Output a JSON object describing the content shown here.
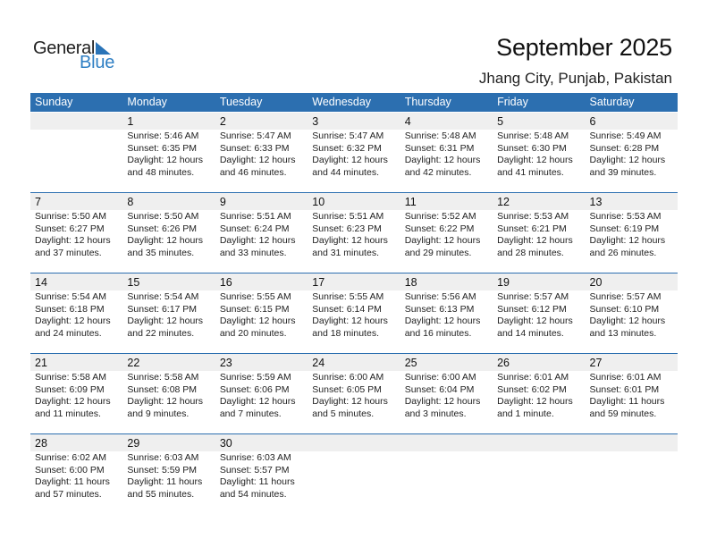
{
  "logo": {
    "general": "General",
    "blue": "Blue"
  },
  "header": {
    "title": "September 2025",
    "location": "Jhang City, Punjab, Pakistan"
  },
  "colors": {
    "accent": "#2c6fb0",
    "band": "#efefef",
    "logo_blue": "#2f7fc4"
  },
  "weekdays": [
    "Sunday",
    "Monday",
    "Tuesday",
    "Wednesday",
    "Thursday",
    "Friday",
    "Saturday"
  ],
  "weeks": [
    [
      null,
      {
        "day": "1",
        "sunrise": "Sunrise: 5:46 AM",
        "sunset": "Sunset: 6:35 PM",
        "daylight1": "Daylight: 12 hours",
        "daylight2": "and 48 minutes."
      },
      {
        "day": "2",
        "sunrise": "Sunrise: 5:47 AM",
        "sunset": "Sunset: 6:33 PM",
        "daylight1": "Daylight: 12 hours",
        "daylight2": "and 46 minutes."
      },
      {
        "day": "3",
        "sunrise": "Sunrise: 5:47 AM",
        "sunset": "Sunset: 6:32 PM",
        "daylight1": "Daylight: 12 hours",
        "daylight2": "and 44 minutes."
      },
      {
        "day": "4",
        "sunrise": "Sunrise: 5:48 AM",
        "sunset": "Sunset: 6:31 PM",
        "daylight1": "Daylight: 12 hours",
        "daylight2": "and 42 minutes."
      },
      {
        "day": "5",
        "sunrise": "Sunrise: 5:48 AM",
        "sunset": "Sunset: 6:30 PM",
        "daylight1": "Daylight: 12 hours",
        "daylight2": "and 41 minutes."
      },
      {
        "day": "6",
        "sunrise": "Sunrise: 5:49 AM",
        "sunset": "Sunset: 6:28 PM",
        "daylight1": "Daylight: 12 hours",
        "daylight2": "and 39 minutes."
      }
    ],
    [
      {
        "day": "7",
        "sunrise": "Sunrise: 5:50 AM",
        "sunset": "Sunset: 6:27 PM",
        "daylight1": "Daylight: 12 hours",
        "daylight2": "and 37 minutes."
      },
      {
        "day": "8",
        "sunrise": "Sunrise: 5:50 AM",
        "sunset": "Sunset: 6:26 PM",
        "daylight1": "Daylight: 12 hours",
        "daylight2": "and 35 minutes."
      },
      {
        "day": "9",
        "sunrise": "Sunrise: 5:51 AM",
        "sunset": "Sunset: 6:24 PM",
        "daylight1": "Daylight: 12 hours",
        "daylight2": "and 33 minutes."
      },
      {
        "day": "10",
        "sunrise": "Sunrise: 5:51 AM",
        "sunset": "Sunset: 6:23 PM",
        "daylight1": "Daylight: 12 hours",
        "daylight2": "and 31 minutes."
      },
      {
        "day": "11",
        "sunrise": "Sunrise: 5:52 AM",
        "sunset": "Sunset: 6:22 PM",
        "daylight1": "Daylight: 12 hours",
        "daylight2": "and 29 minutes."
      },
      {
        "day": "12",
        "sunrise": "Sunrise: 5:53 AM",
        "sunset": "Sunset: 6:21 PM",
        "daylight1": "Daylight: 12 hours",
        "daylight2": "and 28 minutes."
      },
      {
        "day": "13",
        "sunrise": "Sunrise: 5:53 AM",
        "sunset": "Sunset: 6:19 PM",
        "daylight1": "Daylight: 12 hours",
        "daylight2": "and 26 minutes."
      }
    ],
    [
      {
        "day": "14",
        "sunrise": "Sunrise: 5:54 AM",
        "sunset": "Sunset: 6:18 PM",
        "daylight1": "Daylight: 12 hours",
        "daylight2": "and 24 minutes."
      },
      {
        "day": "15",
        "sunrise": "Sunrise: 5:54 AM",
        "sunset": "Sunset: 6:17 PM",
        "daylight1": "Daylight: 12 hours",
        "daylight2": "and 22 minutes."
      },
      {
        "day": "16",
        "sunrise": "Sunrise: 5:55 AM",
        "sunset": "Sunset: 6:15 PM",
        "daylight1": "Daylight: 12 hours",
        "daylight2": "and 20 minutes."
      },
      {
        "day": "17",
        "sunrise": "Sunrise: 5:55 AM",
        "sunset": "Sunset: 6:14 PM",
        "daylight1": "Daylight: 12 hours",
        "daylight2": "and 18 minutes."
      },
      {
        "day": "18",
        "sunrise": "Sunrise: 5:56 AM",
        "sunset": "Sunset: 6:13 PM",
        "daylight1": "Daylight: 12 hours",
        "daylight2": "and 16 minutes."
      },
      {
        "day": "19",
        "sunrise": "Sunrise: 5:57 AM",
        "sunset": "Sunset: 6:12 PM",
        "daylight1": "Daylight: 12 hours",
        "daylight2": "and 14 minutes."
      },
      {
        "day": "20",
        "sunrise": "Sunrise: 5:57 AM",
        "sunset": "Sunset: 6:10 PM",
        "daylight1": "Daylight: 12 hours",
        "daylight2": "and 13 minutes."
      }
    ],
    [
      {
        "day": "21",
        "sunrise": "Sunrise: 5:58 AM",
        "sunset": "Sunset: 6:09 PM",
        "daylight1": "Daylight: 12 hours",
        "daylight2": "and 11 minutes."
      },
      {
        "day": "22",
        "sunrise": "Sunrise: 5:58 AM",
        "sunset": "Sunset: 6:08 PM",
        "daylight1": "Daylight: 12 hours",
        "daylight2": "and 9 minutes."
      },
      {
        "day": "23",
        "sunrise": "Sunrise: 5:59 AM",
        "sunset": "Sunset: 6:06 PM",
        "daylight1": "Daylight: 12 hours",
        "daylight2": "and 7 minutes."
      },
      {
        "day": "24",
        "sunrise": "Sunrise: 6:00 AM",
        "sunset": "Sunset: 6:05 PM",
        "daylight1": "Daylight: 12 hours",
        "daylight2": "and 5 minutes."
      },
      {
        "day": "25",
        "sunrise": "Sunrise: 6:00 AM",
        "sunset": "Sunset: 6:04 PM",
        "daylight1": "Daylight: 12 hours",
        "daylight2": "and 3 minutes."
      },
      {
        "day": "26",
        "sunrise": "Sunrise: 6:01 AM",
        "sunset": "Sunset: 6:02 PM",
        "daylight1": "Daylight: 12 hours",
        "daylight2": "and 1 minute."
      },
      {
        "day": "27",
        "sunrise": "Sunrise: 6:01 AM",
        "sunset": "Sunset: 6:01 PM",
        "daylight1": "Daylight: 11 hours",
        "daylight2": "and 59 minutes."
      }
    ],
    [
      {
        "day": "28",
        "sunrise": "Sunrise: 6:02 AM",
        "sunset": "Sunset: 6:00 PM",
        "daylight1": "Daylight: 11 hours",
        "daylight2": "and 57 minutes."
      },
      {
        "day": "29",
        "sunrise": "Sunrise: 6:03 AM",
        "sunset": "Sunset: 5:59 PM",
        "daylight1": "Daylight: 11 hours",
        "daylight2": "and 55 minutes."
      },
      {
        "day": "30",
        "sunrise": "Sunrise: 6:03 AM",
        "sunset": "Sunset: 5:57 PM",
        "daylight1": "Daylight: 11 hours",
        "daylight2": "and 54 minutes."
      },
      null,
      null,
      null,
      null
    ]
  ]
}
